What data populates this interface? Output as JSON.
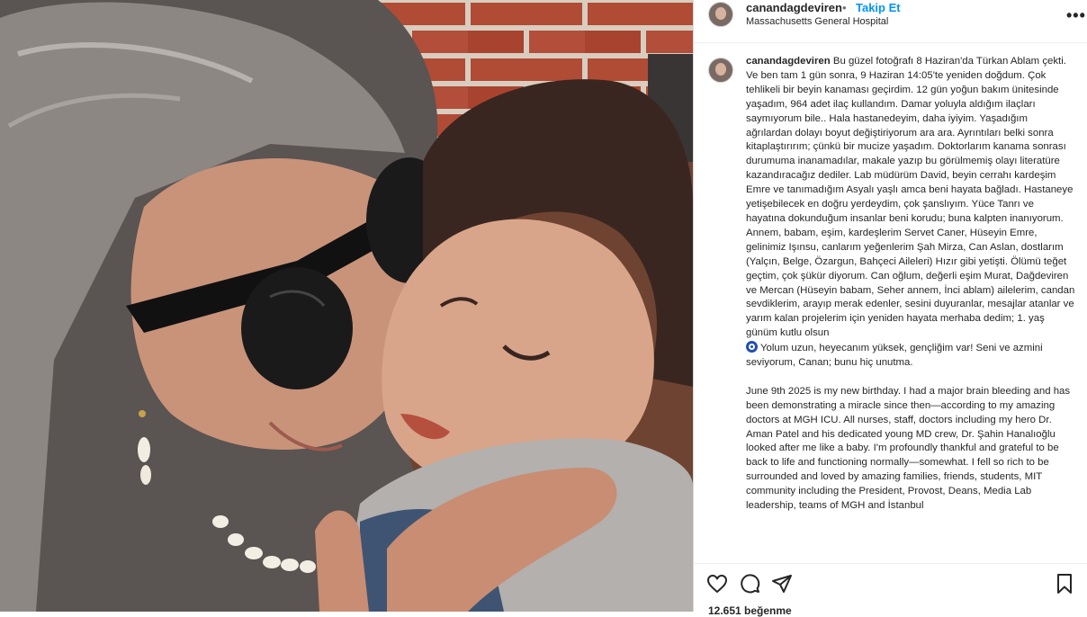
{
  "post": {
    "username": "canandagdeviren",
    "separator": "•",
    "follow_label": "Takip Et",
    "location": "Massachusetts General Hospital",
    "more_label": "•••",
    "photo_icon": "photo",
    "caption_user": "canandagdeviren",
    "caption_tr": "Bu güzel fotoğrafı 8 Haziran'da Türkan Ablam çekti. Ve ben tam 1 gün sonra, 9 Haziran 14:05'te yeniden doğdum. Çok tehlikeli bir beyin kanaması geçirdim. 12 gün yoğun bakım ünitesinde yaşadım, 964 adet ilaç kullandım. Damar yoluyla aldığım ilaçları saymıyorum bile.. Hala hastanedeyim, daha iyiyim. Yaşadığım ağrılardan dolayı boyut değiştiriyorum ara ara. Ayrıntıları belki sonra kitaplaştırırım; çünkü bir mucize yaşadım. Doktorlarım kanama sonrası durumuma inanamadılar, makale yazıp bu görülmemiş olayı literatüre kazandıracağız dediler. Lab müdürüm David, beyin cerrahı kardeşim Emre ve tanımadığım Asyalı yaşlı amca beni hayata bağladı. Hastaneye yetişebilecek en doğru yerdeydim, çok şanslıyım. Yüce Tanrı ve hayatına dokunduğum insanlar beni korudu; buna kalpten inanıyorum. Annem, babam, eşim, kardeşlerim Servet Caner, Hüseyin Emre, gelinimiz Işınsu, canlarım yeğenlerim Şah Mirza, Can Aslan, dostlarım (Yalçın, Belge, Özargun, Bahçeci Aileleri) Hızır gibi yetişti. Ölümü teğet geçtim, çok şükür diyorum. Can oğlum, değerli eşim Murat, Dağdeviren ve Mercan (Hüseyin babam, Seher annem, İnci ablam) ailelerim, candan sevdiklerim, arayıp merak edenler, sesini duyuranlar, mesajlar atanlar ve yarım kalan projelerim için yeniden hayata merhaba dedim; 1. yaş günüm kutlu olsun",
    "caption_tr_end": "Yolum uzun, heyecanım yüksek, gençliğim var! Seni ve azmini seviyorum, Canan; bunu hiç unutma.",
    "emoji_icon": "nazar-boncugu-icon",
    "caption_en": "June 9th 2025 is my new birthday. I had a major brain bleeding and has been demonstrating a miracle since then—according to my amazing doctors at MGH ICU. All nurses, staff, doctors including my hero Dr. Aman Patel and his dedicated young MD crew, Dr. Şahin Hanalıoğlu looked after me like a baby. I'm profoundly thankful and grateful to be back to life and functioning normally—somewhat. I fell so rich to be surrounded and loved by amazing families, friends, students, MIT community including the President, Provost, Deans, Media Lab leadership, teams of MGH and İstanbul",
    "likes": "12.651 beğenme"
  },
  "actions": {
    "like_icon": "heart-icon",
    "comment_icon": "comment-icon",
    "share_icon": "send-icon",
    "save_icon": "bookmark-icon"
  },
  "colors": {
    "link_blue": "#0095f6",
    "text": "#262626",
    "muted": "#737373",
    "divider": "#efefef"
  }
}
